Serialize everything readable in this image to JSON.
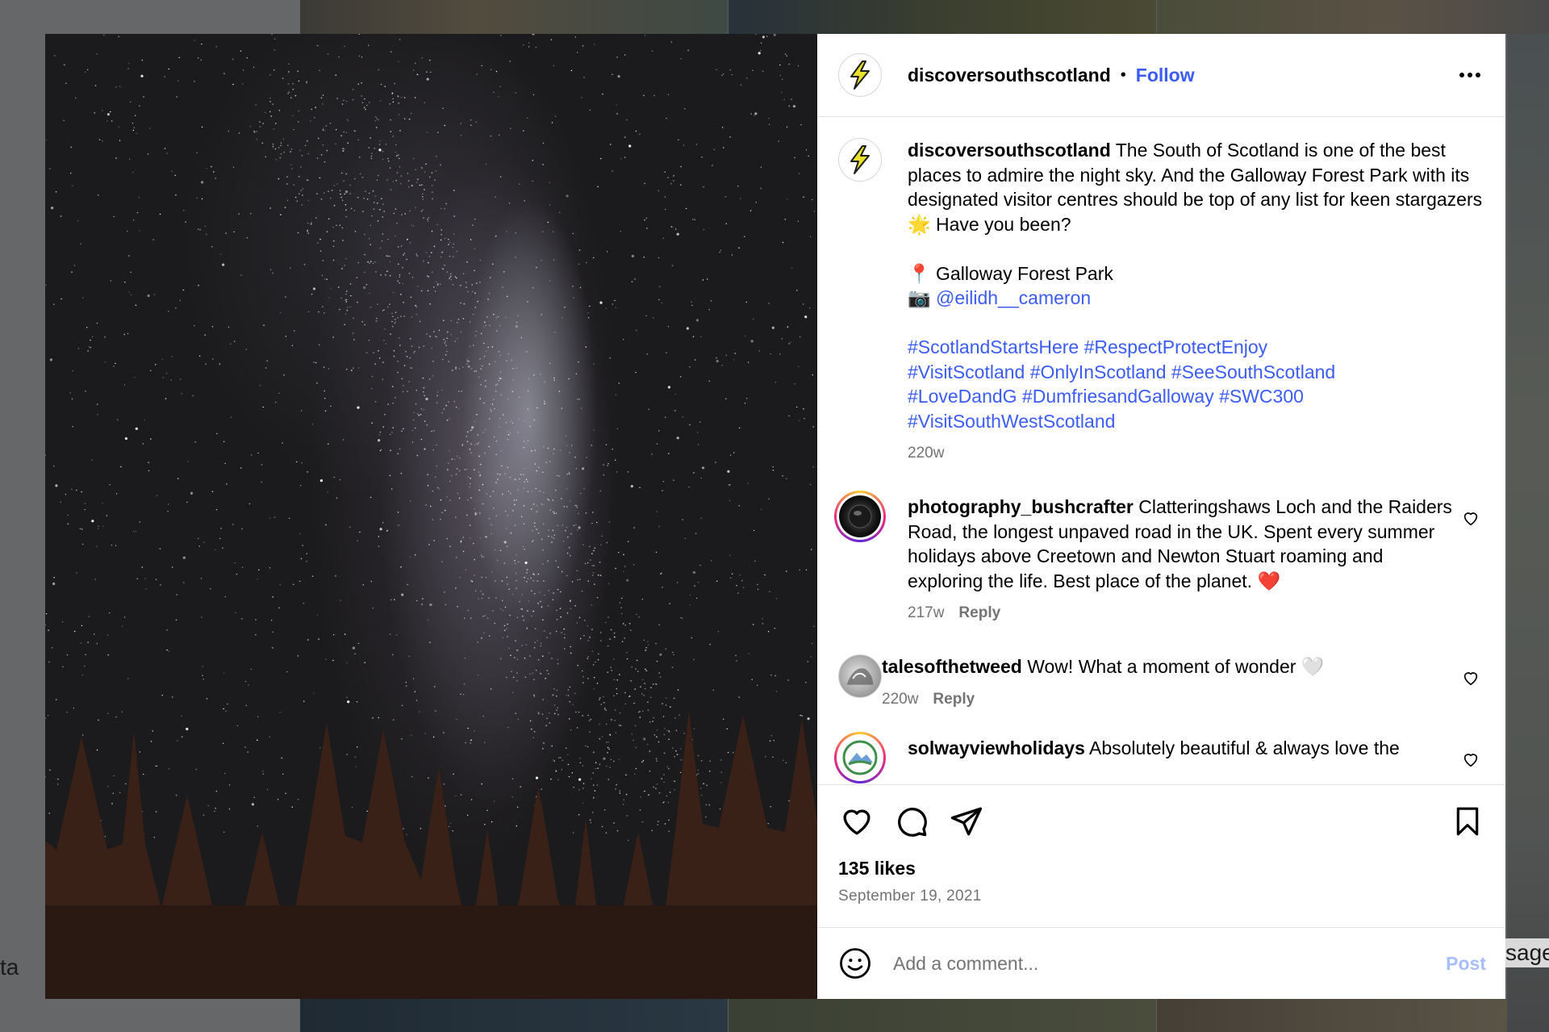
{
  "background": {
    "left_edge_text": "ta",
    "right_edge_text": "sage"
  },
  "post": {
    "author": "discoversouthscotland",
    "follow_label": "Follow",
    "separator": "•",
    "more_icon": "more-horizontal-icon"
  },
  "caption": {
    "username": "discoversouthscotland",
    "text": " The South of Scotland is one of the best places to admire the night sky. And the Galloway Forest Park with its designated visitor centres should be top of any list for keen stargazers 🌟 Have you been?",
    "location_emoji": "📍",
    "location": " Galloway Forest Park",
    "camera_emoji": "📷",
    "credit": "@eilidh__cameron",
    "hashtags_line1": "#ScotlandStartsHere #RespectProtectEnjoy",
    "hashtags_line2": "#VisitScotland #OnlyInScotland #SeeSouthScotland",
    "hashtags_line3": "#LoveDandG #DumfriesandGalloway #SWC300",
    "hashtags_line4": "#VisitSouthWestScotland",
    "time": "220w"
  },
  "comments": [
    {
      "username": "photography_bushcrafter",
      "text": " Clatteringshaws Loch and the Raiders Road, the longest unpaved road in the UK. Spent every summer holidays above Creetown and Newton Stuart roaming and exploring the life. Best place of the planet. ❤️",
      "time": "217w",
      "reply": "Reply"
    },
    {
      "username": "talesofthetweed",
      "text": " Wow! What a moment of wonder 🤍",
      "time": "220w",
      "reply": "Reply"
    },
    {
      "username": "solwayviewholidays",
      "text": " Absolutely beautiful & always love the"
    }
  ],
  "actions": {
    "likes": "135 likes",
    "date": "September 19, 2021"
  },
  "composer": {
    "placeholder": "Add a comment...",
    "post_label": "Post"
  },
  "colors": {
    "link": "#3b5cf6",
    "post_disabled": "#a8bdfb",
    "muted": "#737373"
  }
}
